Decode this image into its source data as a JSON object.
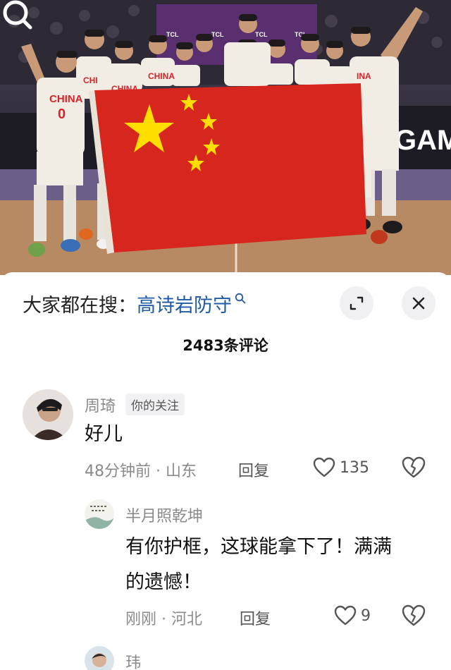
{
  "hero": {
    "jersey_text": "CHINA",
    "jersey_number": "0",
    "sponsor_text": "TCL",
    "banner_text": "GAM"
  },
  "search": {
    "prefix": "大家都在搜：",
    "term": "高诗岩防守"
  },
  "comment_count": "2483条评论",
  "comments": [
    {
      "user": "周琦",
      "badge": "你的关注",
      "text": "好儿",
      "time_location": "48分钟前 · 山东",
      "reply_label": "回复",
      "likes": "135"
    },
    {
      "user": "半月照乾坤",
      "text": "有你护框，这球能拿下了！满满的遗憾！",
      "text_line1": "有你护框，这球能拿下了！满满",
      "text_line2": "的遗憾！",
      "time_location": "刚刚 · 河北",
      "reply_label": "回复",
      "likes": "9"
    },
    {
      "user": "玮"
    }
  ],
  "colors": {
    "link_blue": "#1f5aa6",
    "muted_gray": "#8a8a8a",
    "flag_red": "#d7261e",
    "flag_yellow": "#ffde00"
  }
}
